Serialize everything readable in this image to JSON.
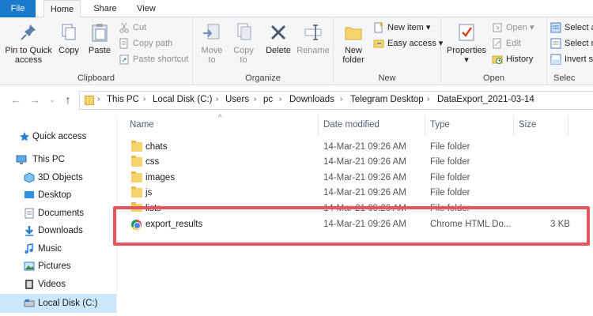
{
  "tabs": {
    "file": "File",
    "home": "Home",
    "share": "Share",
    "view": "View"
  },
  "ribbon": {
    "clipboard": {
      "pin_to_quick_access": "Pin to Quick access",
      "copy": "Copy",
      "paste": "Paste",
      "cut": "Cut",
      "copy_path": "Copy path",
      "paste_shortcut": "Paste shortcut",
      "label": "Clipboard"
    },
    "organize": {
      "move_to": "Move to",
      "copy_to": "Copy to",
      "delete": "Delete",
      "rename": "Rename",
      "label": "Organize"
    },
    "new": {
      "new_folder": "New folder",
      "new_item": "New item",
      "easy_access": "Easy access",
      "label": "New"
    },
    "open": {
      "properties": "Properties",
      "open": "Open",
      "edit": "Edit",
      "history": "History",
      "label": "Open"
    },
    "select": {
      "select_all": "Select all",
      "select_none": "Select no",
      "invert_selection": "Invert se",
      "label": "Selec"
    }
  },
  "address": {
    "crumbs": [
      "This PC",
      "Local Disk (C:)",
      "Users",
      "pc",
      "Downloads",
      "Telegram Desktop",
      "DataExport_2021-03-14"
    ]
  },
  "nav": {
    "items": [
      "Quick access",
      "This PC",
      "3D Objects",
      "Desktop",
      "Documents",
      "Downloads",
      "Music",
      "Pictures",
      "Videos",
      "Local Disk (C:)"
    ]
  },
  "columns": {
    "name": "Name",
    "date": "Date modified",
    "type": "Type",
    "size": "Size"
  },
  "files": [
    {
      "name": "chats",
      "date": "14-Mar-21 09:26 AM",
      "type": "File folder",
      "size": "",
      "icon": "folder-icon"
    },
    {
      "name": "css",
      "date": "14-Mar-21 09:26 AM",
      "type": "File folder",
      "size": "",
      "icon": "folder-icon"
    },
    {
      "name": "images",
      "date": "14-Mar-21 09:26 AM",
      "type": "File folder",
      "size": "",
      "icon": "folder-icon"
    },
    {
      "name": "js",
      "date": "14-Mar-21 09:26 AM",
      "type": "File folder",
      "size": "",
      "icon": "folder-icon"
    },
    {
      "name": "lists",
      "date": "14-Mar-21 09:26 AM",
      "type": "File folder",
      "size": "",
      "icon": "folder-icon"
    },
    {
      "name": "export_results",
      "date": "14-Mar-21 09:26 AM",
      "type": "Chrome HTML Do...",
      "size": "3 KB",
      "icon": "chrome-html-icon"
    }
  ],
  "colors": {
    "accent": "#1979ca",
    "highlight": "#e8565d",
    "selection": "#cce8ff",
    "folder": "#f7d36b"
  }
}
